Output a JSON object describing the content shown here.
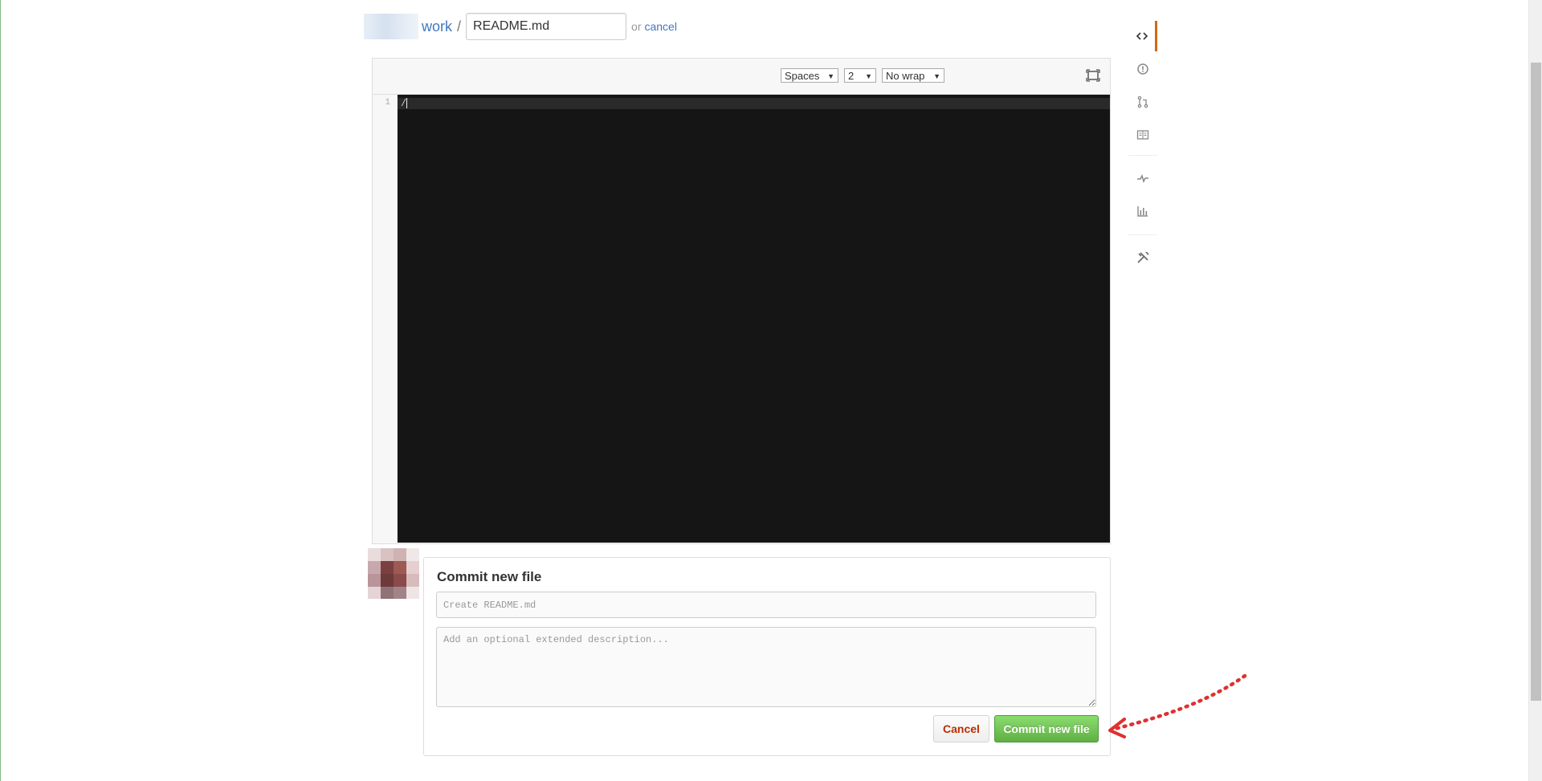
{
  "breadcrumb": {
    "repo": "work",
    "separator": "/",
    "filename_value": "README.md",
    "or_text": "or",
    "cancel_link": "cancel"
  },
  "editor": {
    "indent_mode": "Spaces",
    "indent_size": "2",
    "wrap_mode": "No wrap",
    "line_numbers": [
      "1"
    ],
    "content_lines": [
      "/"
    ]
  },
  "commit": {
    "title": "Commit new file",
    "summary_placeholder": "Create README.md",
    "description_placeholder": "Add an optional extended description...",
    "cancel_button": "Cancel",
    "commit_button": "Commit new file"
  },
  "repo_nav": [
    {
      "icon": "code-icon",
      "selected": true
    },
    {
      "icon": "issue-icon",
      "selected": false
    },
    {
      "icon": "pull-request-icon",
      "selected": false
    },
    {
      "icon": "wiki-icon",
      "selected": false
    },
    {
      "icon": "pulse-icon",
      "selected": false
    },
    {
      "icon": "graph-icon",
      "selected": false
    },
    {
      "icon": "settings-icon",
      "selected": false
    }
  ],
  "colors": {
    "link": "#4078c0",
    "editor_background": "#151515",
    "commit_button": "#60b044",
    "cancel_text": "#bd2c00",
    "nav_selected": "#d26911",
    "annotation_arrow": "#e03030"
  }
}
